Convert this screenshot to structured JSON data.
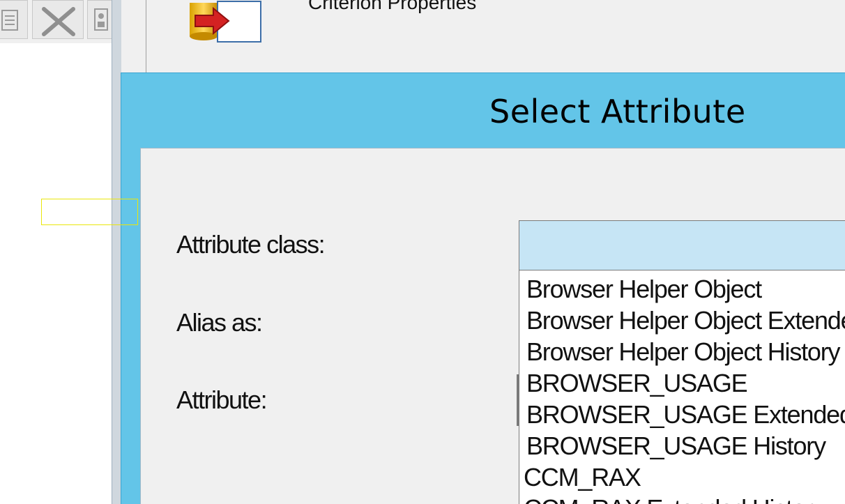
{
  "background_window": {
    "toolbar_icons": [
      "document-icon",
      "delete-x-icon",
      "properties-icon"
    ]
  },
  "properties_window": {
    "title": "Criterion Properties",
    "icon": "criterion-properties-icon"
  },
  "dialog": {
    "title": "Select Attribute",
    "labels": {
      "attribute_class": "Attribute class:",
      "alias_as": "Alias as:",
      "attribute": "Attribute:"
    },
    "attribute_class_value": "",
    "dropdown_items": [
      "Browser Helper Object",
      "Browser Helper Object Extended",
      "Browser Helper Object History",
      "BROWSER_USAGE",
      "BROWSER_USAGE Extended",
      "BROWSER_USAGE History",
      "CCM_RAX",
      "CCM_RAX Extended History"
    ]
  },
  "colors": {
    "dialog_title_bar": "#63c5e8",
    "dialog_body": "#f0f0f0",
    "combo_selected": "#c6e5f5",
    "selection_marker": "#e9e60c"
  }
}
